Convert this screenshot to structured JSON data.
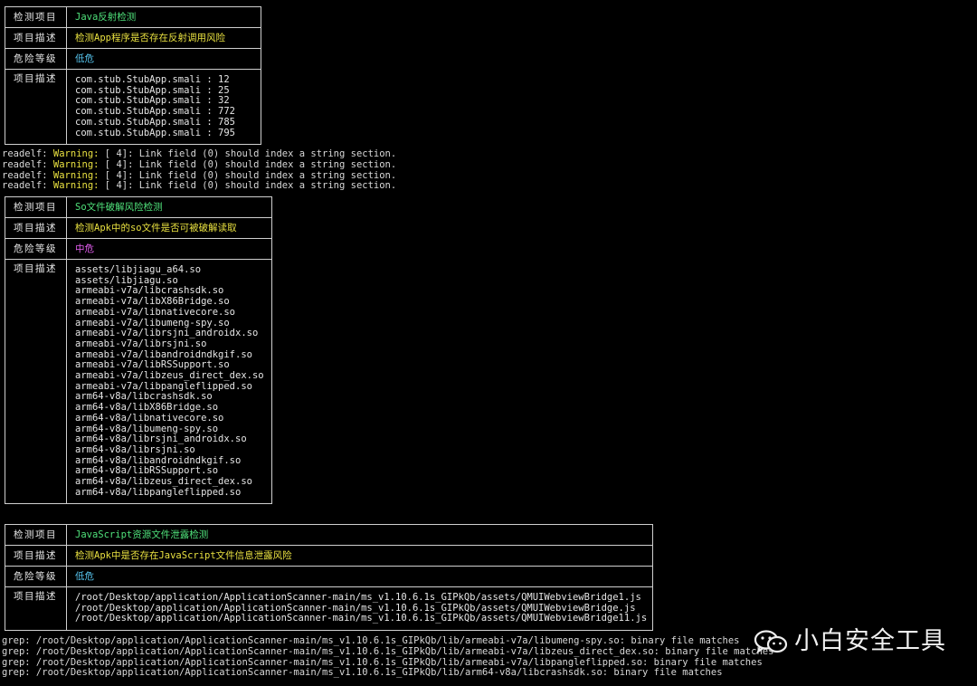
{
  "card1": {
    "rows": [
      {
        "key": "检测项目",
        "value": "Java反射检测",
        "color": "#4fe07a"
      },
      {
        "key": "项目描述",
        "value": "检测App程序是否存在反射调用风险",
        "color": "#e8e040"
      },
      {
        "key": "危险等级",
        "value": "低危",
        "color": "#57c5ee"
      }
    ],
    "detail_key": "项目描述",
    "detail_lines": [
      "com.stub.StubApp.smali : 12",
      "com.stub.StubApp.smali : 25",
      "com.stub.StubApp.smali : 32",
      "com.stub.StubApp.smali : 772",
      "com.stub.StubApp.smali : 785",
      "com.stub.StubApp.smali : 795"
    ]
  },
  "readelf_lines": [
    {
      "prefix": "readelf: ",
      "warning": "Warning:",
      "rest": " [ 4]: Link field (0) should index a string section."
    },
    {
      "prefix": "readelf: ",
      "warning": "Warning:",
      "rest": " [ 4]: Link field (0) should index a string section."
    },
    {
      "prefix": "readelf: ",
      "warning": "Warning:",
      "rest": " [ 4]: Link field (0) should index a string section."
    },
    {
      "prefix": "readelf: ",
      "warning": "Warning:",
      "rest": " [ 4]: Link field (0) should index a string section."
    }
  ],
  "card2": {
    "rows": [
      {
        "key": "检测项目",
        "value": "So文件破解风险检测",
        "color": "#4fe07a"
      },
      {
        "key": "项目描述",
        "value": "检测Apk中的so文件是否可被破解读取",
        "color": "#e8e040"
      },
      {
        "key": "危险等级",
        "value": "中危",
        "color": "#e45ef0"
      }
    ],
    "detail_key": "项目描述",
    "detail_lines": [
      "assets/libjiagu_a64.so",
      "assets/libjiagu.so",
      "armeabi-v7a/libcrashsdk.so",
      "armeabi-v7a/libX86Bridge.so",
      "armeabi-v7a/libnativecore.so",
      "armeabi-v7a/libumeng-spy.so",
      "armeabi-v7a/librsjni_androidx.so",
      "armeabi-v7a/librsjni.so",
      "armeabi-v7a/libandroidndkgif.so",
      "armeabi-v7a/libRSSupport.so",
      "armeabi-v7a/libzeus_direct_dex.so",
      "armeabi-v7a/libpangleflipped.so",
      "arm64-v8a/libcrashsdk.so",
      "arm64-v8a/libX86Bridge.so",
      "arm64-v8a/libnativecore.so",
      "arm64-v8a/libumeng-spy.so",
      "arm64-v8a/librsjni_androidx.so",
      "arm64-v8a/librsjni.so",
      "arm64-v8a/libandroidndkgif.so",
      "arm64-v8a/libRSSupport.so",
      "arm64-v8a/libzeus_direct_dex.so",
      "arm64-v8a/libpangleflipped.so"
    ]
  },
  "card3": {
    "rows": [
      {
        "key": "检测项目",
        "value": "JavaScript资源文件泄露检测",
        "color": "#4fe07a"
      },
      {
        "key": "项目描述",
        "value": "检测Apk中是否存在JavaScript文件信息泄露风险",
        "color": "#e8e040"
      },
      {
        "key": "危险等级",
        "value": "低危",
        "color": "#57c5ee"
      }
    ],
    "detail_key": "项目描述",
    "detail_lines": [
      "/root/Desktop/application/ApplicationScanner-main/ms_v1.10.6.1s_GIPkQb/assets/QMUIWebviewBridge1.js",
      "/root/Desktop/application/ApplicationScanner-main/ms_v1.10.6.1s_GIPkQb/assets/QMUIWebviewBridge.js",
      "/root/Desktop/application/ApplicationScanner-main/ms_v1.10.6.1s_GIPkQb/assets/QMUIWebviewBridge11.js"
    ]
  },
  "grep_lines": [
    "grep: /root/Desktop/application/ApplicationScanner-main/ms_v1.10.6.1s_GIPkQb/lib/armeabi-v7a/libumeng-spy.so: binary file matches",
    "grep: /root/Desktop/application/ApplicationScanner-main/ms_v1.10.6.1s_GIPkQb/lib/armeabi-v7a/libzeus_direct_dex.so: binary file matches",
    "grep: /root/Desktop/application/ApplicationScanner-main/ms_v1.10.6.1s_GIPkQb/lib/armeabi-v7a/libpangleflipped.so: binary file matches",
    "grep: /root/Desktop/application/ApplicationScanner-main/ms_v1.10.6.1s_GIPkQb/lib/arm64-v8a/libcrashsdk.so: binary file matches"
  ],
  "watermark": {
    "text": "小白安全工具",
    "icon": "wechat-icon"
  }
}
